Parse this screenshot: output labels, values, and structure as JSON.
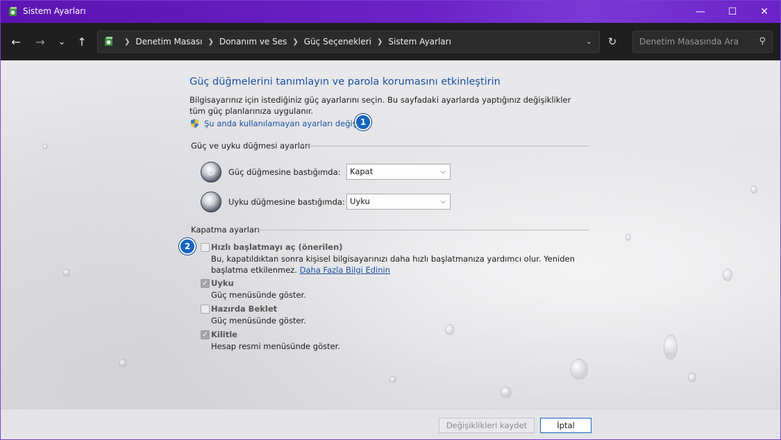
{
  "window": {
    "title": "Sistem Ayarları",
    "controls": {
      "minimize": "—",
      "maximize": "☐",
      "close": "✕"
    }
  },
  "nav": {
    "back": "←",
    "forward": "→",
    "recent": "⌄",
    "up": "↑",
    "breadcrumbs": [
      "Denetim Masası",
      "Donanım ve Ses",
      "Güç Seçenekleri",
      "Sistem Ayarları"
    ],
    "refresh": "↻",
    "search_placeholder": "Denetim Masasında Ara"
  },
  "main": {
    "heading": "Güç düğmelerini tanımlayın ve parola korumasını etkinleştirin",
    "description": "Bilgisayarınız için istediğiniz güç ayarlarını seçin. Bu sayfadaki ayarlarda yaptığınız değişiklikler tüm güç planlarınıza uygulanır.",
    "change_link": "Şu anda kullanılamayan ayarları değiştir",
    "badge1": "1",
    "badge2": "2",
    "power_section": {
      "title": "Güç ve uyku düğmesi ayarları",
      "power_button_label": "Güç düğmesine bastığımda:",
      "power_button_value": "Kapat",
      "sleep_button_label": "Uyku düğmesine bastığımda:",
      "sleep_button_value": "Uyku"
    },
    "shutdown_section": {
      "title": "Kapatma ayarları",
      "fast_startup": {
        "title": "Hızlı başlatmayı aç (önerilen)",
        "desc": "Bu, kapatıldıktan sonra kişisel bilgisayarınızı daha hızlı başlatmanıza yardımcı olur. Yeniden başlatma etkilenmez.",
        "link": "Daha Fazla Bilgi Edinin",
        "checked": false
      },
      "sleep": {
        "title": "Uyku",
        "desc": "Güç menüsünde göster.",
        "checked": true
      },
      "hibernate": {
        "title": "Hazırda Beklet",
        "desc": "Güç menüsünde göster.",
        "checked": false
      },
      "lock": {
        "title": "Kilitle",
        "desc": "Hesap resmi menüsünde göster.",
        "checked": true
      }
    }
  },
  "footer": {
    "save_label": "Değişiklikleri kaydet",
    "cancel_label": "İptal"
  },
  "colors": {
    "titlebar": "#6b22c8",
    "link": "#1b4f9c",
    "badge": "#1565c0"
  }
}
